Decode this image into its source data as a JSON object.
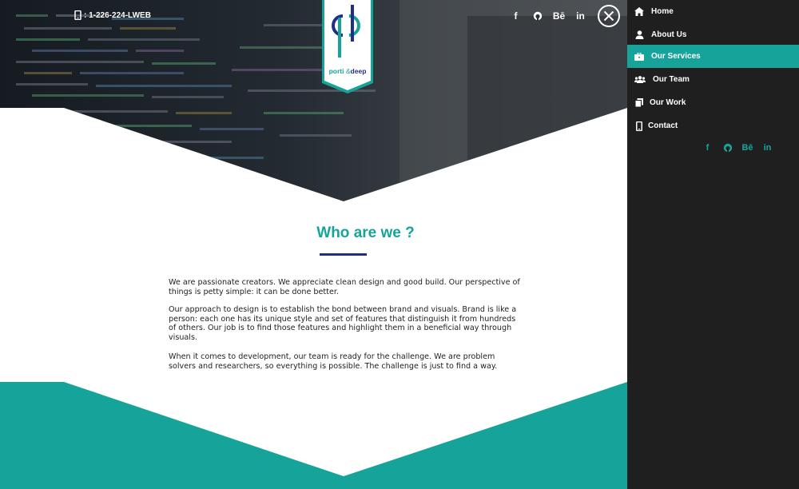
{
  "header": {
    "phone": ": 1-226-224-LWEB",
    "logo_left": "porti",
    "logo_amp": "&",
    "logo_right": "deep",
    "social": [
      {
        "name": "facebook-icon",
        "glyph": "f"
      },
      {
        "name": "github-icon",
        "glyph": ""
      },
      {
        "name": "behance-icon",
        "glyph": "Bē"
      },
      {
        "name": "linkedin-icon",
        "glyph": "in"
      }
    ]
  },
  "about": {
    "title": "Who are we ?",
    "paragraphs": [
      "We are passionate creators. We appreciate clean design and good build. Our perspective of things is petty simple: it can be done better.",
      "Our approach to design is to establish the bond between brand and visuals. Brand is like a person: each one has its unique style and set of features that distinguish it from hundreds of others. Our job is to find those features and highlight them in a beneficial way through visuals.",
      "When it comes to development, our team is ready for the challenge. We are problem solvers and researchers, so everything is possible. The challenge is just to find a way."
    ]
  },
  "menu": {
    "items": [
      {
        "label": "Home",
        "icon": "home-icon",
        "active": false
      },
      {
        "label": "About Us",
        "icon": "user-icon",
        "active": false
      },
      {
        "label": "Our Services",
        "icon": "briefcase-icon",
        "active": true
      },
      {
        "label": "Our Team",
        "icon": "team-icon",
        "active": false
      },
      {
        "label": "Our Work",
        "icon": "portfolio-icon",
        "active": false
      },
      {
        "label": "Contact",
        "icon": "phone-icon",
        "active": false
      }
    ],
    "social": [
      {
        "name": "facebook-icon",
        "glyph": "f"
      },
      {
        "name": "github-icon",
        "glyph": ""
      },
      {
        "name": "behance-icon",
        "glyph": "Bē"
      },
      {
        "name": "linkedin-icon",
        "glyph": "in"
      }
    ]
  },
  "colors": {
    "accent": "#16a49a",
    "navy": "#1f2f86",
    "side_bg": "#1f1f1f"
  }
}
